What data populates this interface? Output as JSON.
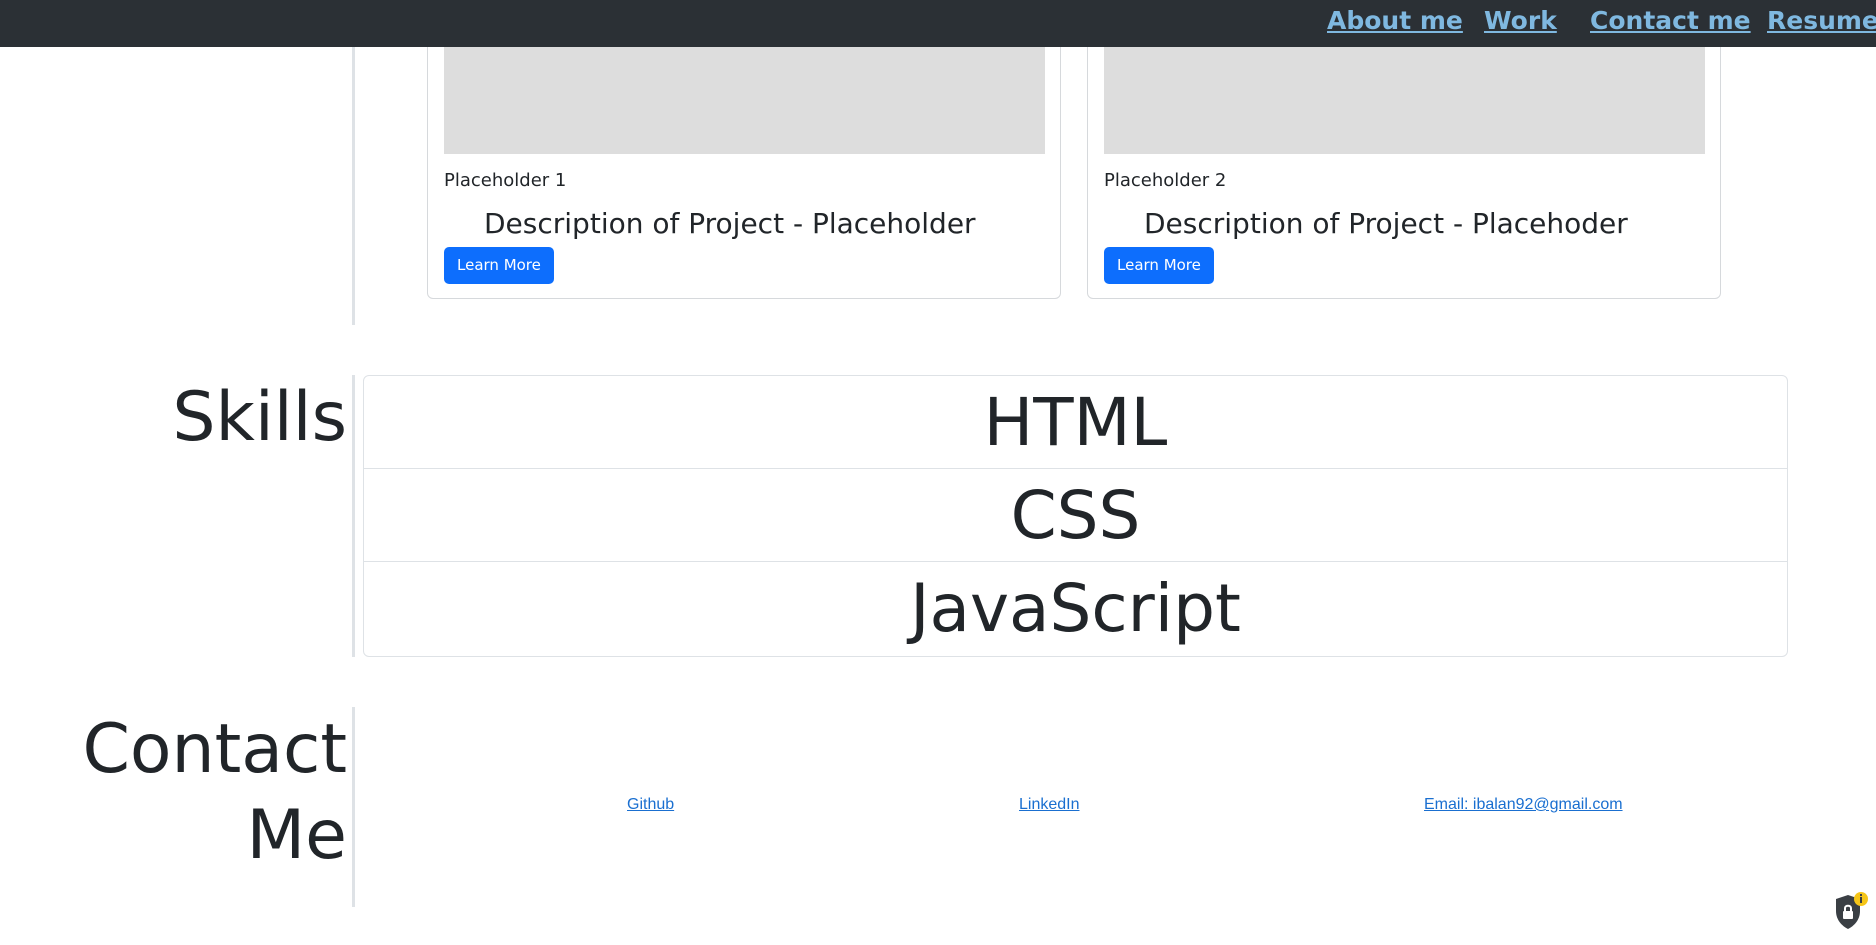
{
  "nav": {
    "about": "About me",
    "work": "Work",
    "contact": "Contact me",
    "resume": "Resume"
  },
  "projects": [
    {
      "title": "Placeholder 1",
      "description": "Description of Project - Placeholder",
      "button": "Learn More"
    },
    {
      "title": "Placeholder 2",
      "description": "Description of Project - Placehoder",
      "button": "Learn More"
    }
  ],
  "skills": {
    "heading": "Skills",
    "items": [
      "HTML",
      "CSS",
      "JavaScript"
    ]
  },
  "contact": {
    "heading_line1": "Contact",
    "heading_line2": "Me",
    "github": "Github",
    "linkedin": "LinkedIn",
    "email": "Email: ibalan92@gmail.com"
  },
  "icons": {
    "nav_link_color": "#7fb8e0",
    "navbar_bg": "#2b3035",
    "button_color": "#0d6efd",
    "extension_icon": "shield-lock-icon"
  }
}
